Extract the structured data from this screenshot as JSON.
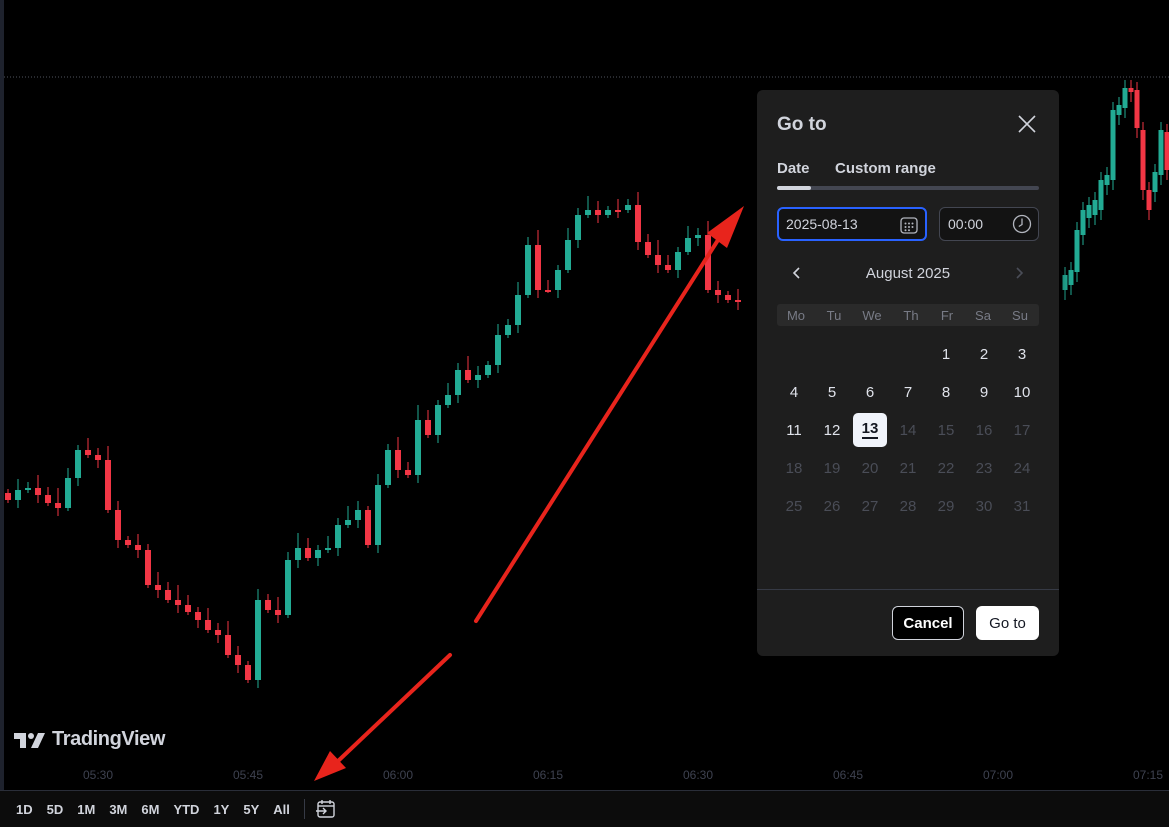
{
  "colors": {
    "up": "#22ab94",
    "down": "#f23645",
    "background": "#000000",
    "accent": "#2962ff",
    "annotation_arrow": "#e8241c"
  },
  "branding": {
    "logo_text": "TradingView",
    "logo_icon": "tradingview-logo-icon"
  },
  "time_axis": {
    "labels": [
      "05:30",
      "05:45",
      "06:00",
      "06:15",
      "06:30",
      "06:45",
      "07:00",
      "07:15"
    ]
  },
  "range_bar": {
    "buttons": [
      "1D",
      "5D",
      "1M",
      "3M",
      "6M",
      "YTD",
      "1Y",
      "5Y",
      "All"
    ],
    "goto_icon": "calendar-goto-icon"
  },
  "dialog": {
    "title": "Go to",
    "close_icon": "close-icon",
    "tabs": [
      {
        "label": "Date",
        "active": true
      },
      {
        "label": "Custom range",
        "active": false
      }
    ],
    "date_value": "2025-08-13",
    "date_icon": "calendar-icon",
    "time_value": "00:00",
    "time_icon": "clock-icon",
    "month_label": "August 2025",
    "prev_icon": "chevron-left-icon",
    "next_icon": "chevron-right-icon",
    "weekdays": [
      "Mo",
      "Tu",
      "We",
      "Th",
      "Fr",
      "Sa",
      "Su"
    ],
    "weeks": [
      [
        "",
        "",
        "",
        "",
        "1",
        "2",
        "3"
      ],
      [
        "4",
        "5",
        "6",
        "7",
        "8",
        "9",
        "10"
      ],
      [
        "11",
        "12",
        "13",
        "14",
        "15",
        "16",
        "17"
      ],
      [
        "18",
        "19",
        "20",
        "21",
        "22",
        "23",
        "24"
      ],
      [
        "25",
        "26",
        "27",
        "28",
        "29",
        "30",
        "31"
      ]
    ],
    "selected_day": 13,
    "last_enabled_day": 13,
    "cancel_label": "Cancel",
    "goto_label": "Go to"
  }
}
